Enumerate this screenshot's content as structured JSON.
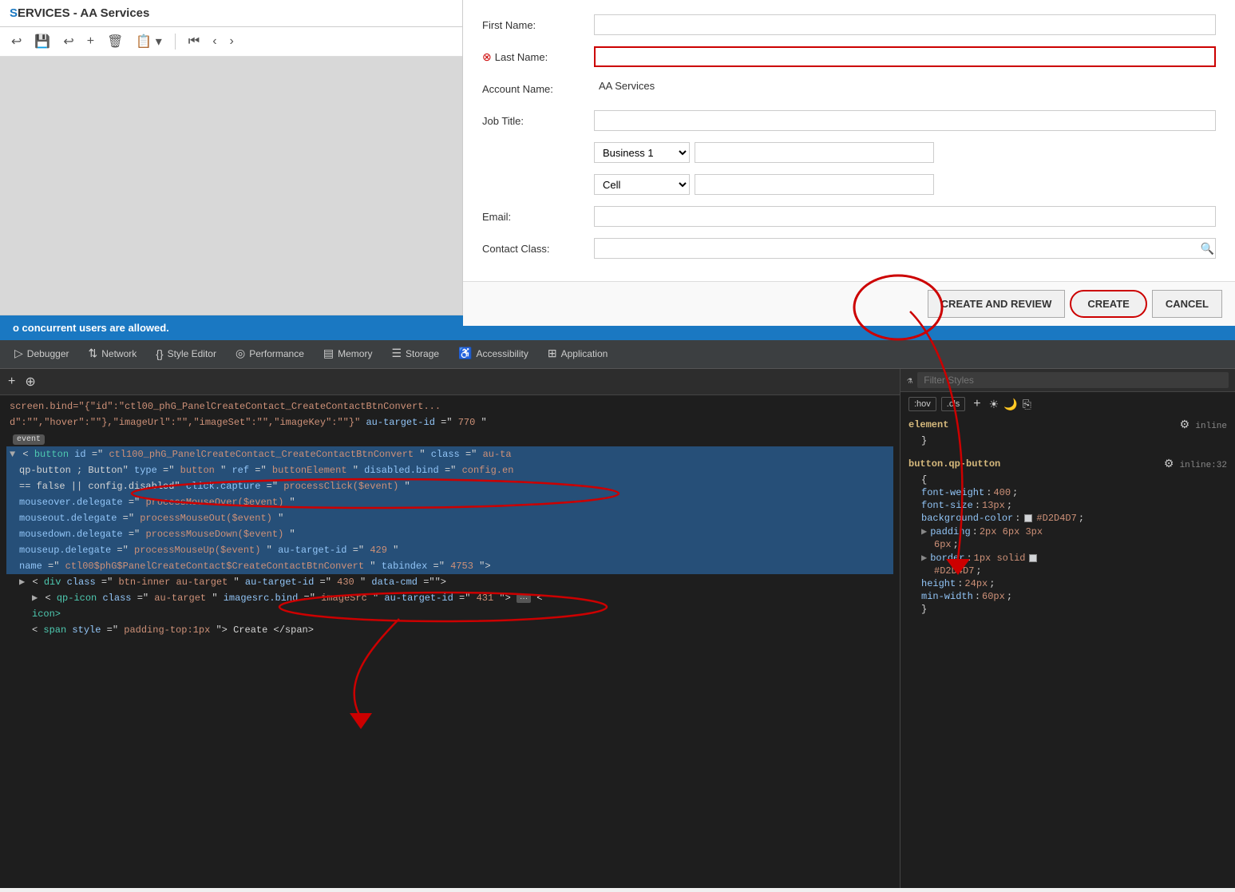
{
  "app": {
    "title": "ERVICES - AA Services"
  },
  "toolbar": {
    "buttons": [
      "↩",
      "💾",
      "↩",
      "+",
      "🗑",
      "📋",
      "⏮",
      "‹",
      "›"
    ]
  },
  "form": {
    "first_name_label": "First Name:",
    "last_name_label": "Last Name:",
    "account_name_label": "Account Name:",
    "account_name_value": "AA Services",
    "job_title_label": "Job Title:",
    "email_label": "Email:",
    "contact_class_label": "Contact Class:",
    "phone_type_1": "Business 1",
    "phone_type_2": "Cell",
    "buttons": {
      "create_and_review": "CREATE AND REVIEW",
      "create": "CREATE",
      "cancel": "CANCEL"
    }
  },
  "status_bar": {
    "message": "o concurrent users are allowed."
  },
  "devtools": {
    "tabs": [
      {
        "label": "Debugger",
        "icon": "▷",
        "active": false
      },
      {
        "label": "Network",
        "icon": "↑↓",
        "active": false
      },
      {
        "label": "Style Editor",
        "icon": "{}",
        "active": false
      },
      {
        "label": "Performance",
        "icon": "◎",
        "active": false
      },
      {
        "label": "Memory",
        "icon": "▤",
        "active": false
      },
      {
        "label": "Storage",
        "icon": "☰",
        "active": false
      },
      {
        "label": "Accessibility",
        "icon": "♿",
        "active": false
      },
      {
        "label": "Application",
        "icon": "⊞",
        "active": false
      }
    ],
    "html_content": {
      "line1": "screen.bind=\"{\"id\":\"ctl00_phG_PanelCreateContact_CreateContactBtnConvert...",
      "line1b": "d\":\"\",\"hover\":\"\"},\"imageUrl\":\"\",\"imageSet\":\"\",\"imageKey\":\"\"}\" au-target-id=\"770\"",
      "event_badge": "event",
      "button_tag": "<button id=\"ctl100_phG_PanelCreateContact_CreateContactBtnConvert\"",
      "button_attrs1": "    qp-button ; Button\" type=\"button\" ref=\"buttonElement\" disabled.bind=\"config.en",
      "button_attrs2": "    == false || config.disabled\" click.capture=\"processClick($event)\"",
      "button_attrs3": "    mouseover.delegate=\"processMouseOver($event)\"",
      "button_attrs4": "    mouseout.delegate=\"processMouseOut($event)\"",
      "button_attrs5": "    mousedown.delegate=\"processMouseDown($event)\"",
      "button_attrs6": "    mouseup.delegate=\"processMouseUp($event)\" au-target-id=\"429\"",
      "button_attrs7": "    name=\"ctl00$phG$PanelCreateContact$CreateContactBtnConvert\" tabindex=\"4753\">",
      "div_line": "  <div class=\"btn-inner au-target\" au-target-id=\"430\" data-cmd=\"\">",
      "qp_icon": "    <qp-icon class=\"au-target\" imagesrc.bind=\"imageSrc\" au-target-id=\"431\"> ··· <",
      "icon_close": "    icon>",
      "span_line": "    <span style=\"padding-top:1px\">Create</span>"
    },
    "css_content": {
      "pseudo_btns": [
        ":hov",
        ".cls"
      ],
      "element_label": "element",
      "inline_label": "inline",
      "close_brace": "}",
      "selector": "button.qp-button",
      "origin": "inline:32",
      "properties": [
        {
          "name": "font-weight",
          "value": "400"
        },
        {
          "name": "font-size",
          "value": "13px"
        },
        {
          "name": "background-color",
          "value": "#D2D4D7",
          "swatch": true,
          "swatch_color": "#D2D4D7"
        },
        {
          "name": "padding",
          "value": "2px 6px 3px 6px",
          "has_arrow": true
        },
        {
          "name": "border",
          "value": "1px solid",
          "swatch": true,
          "swatch_color": "#D2D4D7",
          "has_arrow": true
        },
        {
          "name": "height",
          "value": "24px"
        },
        {
          "name": "min-width",
          "value": "60px"
        }
      ]
    }
  }
}
